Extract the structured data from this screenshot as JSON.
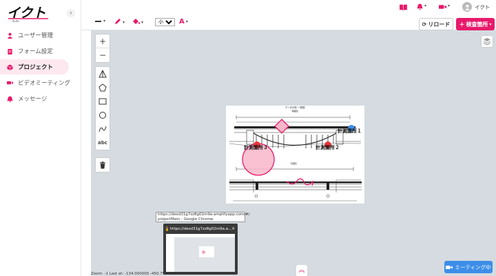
{
  "app": {
    "logo_text": "イクト",
    "logo_sub": "ikuto"
  },
  "sidebar": {
    "items": [
      {
        "label": "ユーザー管理",
        "icon": "user-icon"
      },
      {
        "label": "フォーム設定",
        "icon": "clipboard-icon"
      },
      {
        "label": "プロジェクト",
        "icon": "cube-icon",
        "active": true
      },
      {
        "label": "ビデオミーティング",
        "icon": "video-icon"
      },
      {
        "label": "メッセージ",
        "icon": "bell-icon"
      }
    ]
  },
  "header": {
    "user_name": "イクト"
  },
  "toolbar": {
    "font_size_value": "小",
    "reload_label": "リロード",
    "inspection_label": "検査箇所"
  },
  "drawing": {
    "title": "データ分析 一般図",
    "subtitle": "側面図",
    "plan_label": "平面図",
    "points": [
      "計測箇所１",
      "計測箇所３",
      "計測箇所２"
    ]
  },
  "tooltip": {
    "line1": "https://dexd31g7zz8g02m9a.amplifyapp.com/#/",
    "line2": "projectMain - Google Chrome"
  },
  "thumbnail": {
    "title": "https://dexd31g7zz8g02m9a.a..."
  },
  "status": {
    "text": "Zoom: -1 Last at: -134.000000 -450.750000"
  },
  "meeting": {
    "label": "ミーティング中"
  },
  "colors": {
    "accent": "#e8196a",
    "meeting_blue": "#3d8ee8",
    "canvas": "#d5dbe0"
  }
}
